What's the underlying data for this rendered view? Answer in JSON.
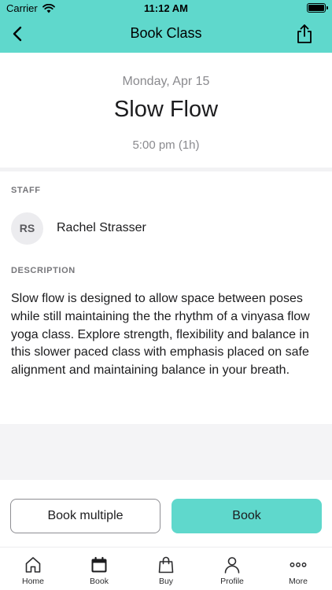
{
  "status_bar": {
    "carrier": "Carrier",
    "time": "11:12 AM"
  },
  "nav": {
    "title": "Book Class",
    "back_icon": "chevron-left-icon",
    "share_icon": "share-icon"
  },
  "class": {
    "date": "Monday, Apr 15",
    "name": "Slow Flow",
    "time": "5:00 pm (1h)"
  },
  "staff": {
    "label": "STAFF",
    "initials": "RS",
    "name": "Rachel Strasser"
  },
  "description": {
    "label": "DESCRIPTION",
    "text": "Slow flow is designed to allow space between poses while still maintaining the the rhythm of a vinyasa flow yoga class. Explore strength, flexibility and balance in this slower paced class with emphasis placed on safe alignment and maintaining balance in your breath."
  },
  "actions": {
    "book_multiple_label": "Book multiple",
    "book_label": "Book"
  },
  "tabs": [
    {
      "label": "Home",
      "icon": "home-icon"
    },
    {
      "label": "Book",
      "icon": "calendar-icon"
    },
    {
      "label": "Buy",
      "icon": "shopping-bag-icon"
    },
    {
      "label": "Profile",
      "icon": "person-icon"
    },
    {
      "label": "More",
      "icon": "more-icon"
    }
  ],
  "colors": {
    "accent": "#5fd8cc"
  }
}
